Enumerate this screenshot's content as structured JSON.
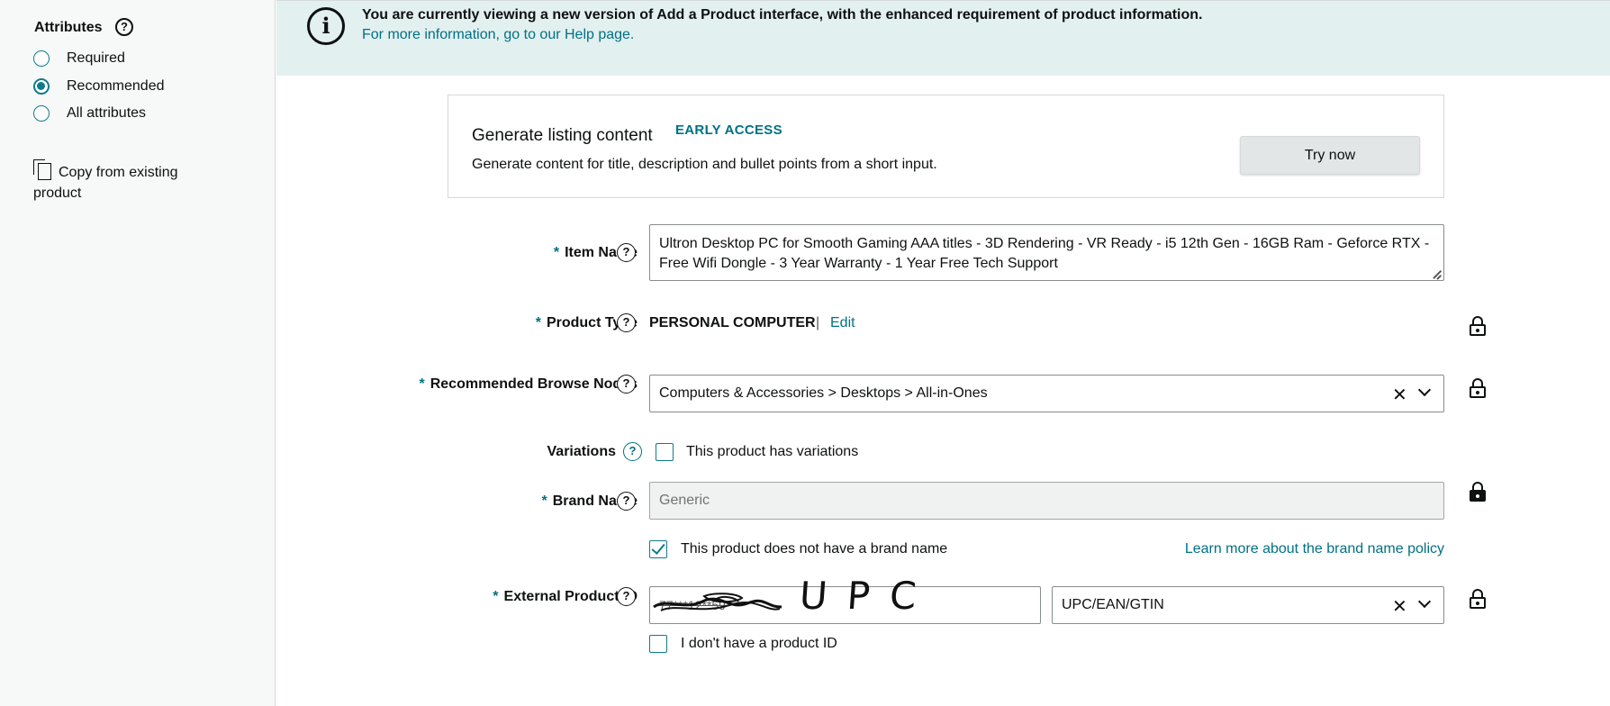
{
  "sidebar": {
    "title": "Attributes",
    "help_glyph": "?",
    "options": [
      {
        "label": "Required",
        "selected": false
      },
      {
        "label": "Recommended",
        "selected": true
      },
      {
        "label": "All attributes",
        "selected": false
      }
    ],
    "copy_link": "Copy from existing product",
    "icons": {
      "help": "question-circle-icon",
      "copy": "copy-icon"
    }
  },
  "banner": {
    "icon_glyph": "i",
    "message": "You are currently viewing a new version of Add a Product interface, with the enhanced requirement of product information.",
    "link": "For more information, go to our Help page."
  },
  "generate": {
    "title": "Generate listing content",
    "badge": "EARLY ACCESS",
    "description": "Generate content for title, description and bullet points from a short input.",
    "button": "Try now"
  },
  "form": {
    "required_mark": "*",
    "item_name": {
      "label": "Item Name",
      "value": "Ultron Desktop PC for Smooth Gaming AAA titles - 3D Rendering - VR Ready - i5 12th Gen - 16GB Ram - Geforce RTX - Free Wifi Dongle - 3 Year Warranty - 1 Year Free Tech Support"
    },
    "product_type": {
      "label": "Product Type",
      "value": "PERSONAL COMPUTER",
      "separator": "|",
      "edit": "Edit"
    },
    "browse_nodes": {
      "label": "Recommended Browse Nodes",
      "value": "Computers & Accessories > Desktops > All-in-Ones",
      "clear_glyph": "✕"
    },
    "variations": {
      "label": "Variations",
      "checkbox_label": "This product has variations",
      "checked": false
    },
    "brand_name": {
      "label": "Brand Name",
      "placeholder": "Generic",
      "no_brand_label": "This product does not have a brand name",
      "no_brand_checked": true,
      "policy_link": "Learn more about the brand name policy"
    },
    "external_id": {
      "label": "External Product ID",
      "value_obscured": "77***12**59",
      "handwriting": "UPC",
      "id_type": "UPC/EAN/GTIN",
      "clear_glyph": "✕",
      "no_id_label": "I don't have a product ID",
      "no_id_checked": false
    }
  },
  "colors": {
    "accent": "#007185",
    "banner_bg": "#e3f0f0",
    "sidebar_bg": "#f7f8f8"
  }
}
